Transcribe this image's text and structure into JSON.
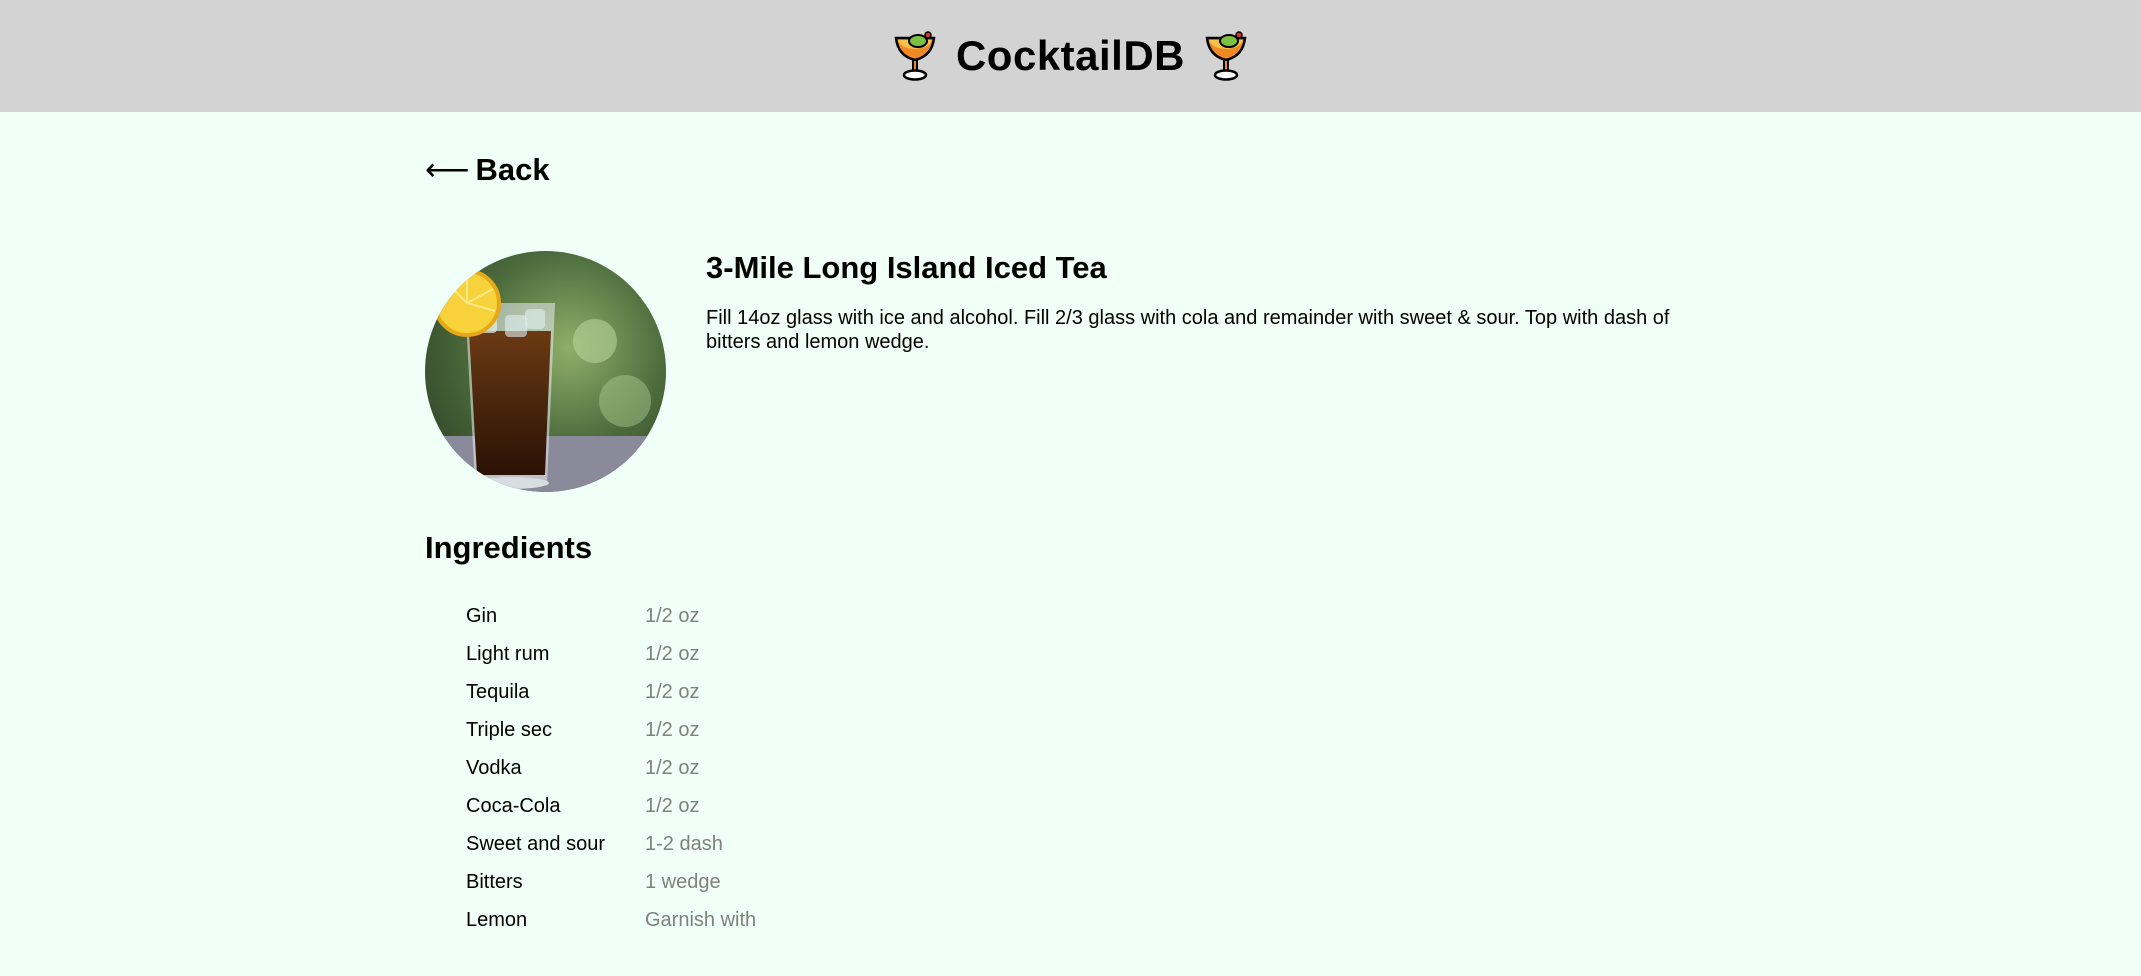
{
  "header": {
    "title": "CocktailDB",
    "left_icon": "cocktail-icon",
    "right_icon": "cocktail-icon",
    "background": "#d3d3d3"
  },
  "nav": {
    "back_arrow": "⟵",
    "back_label": "Back"
  },
  "drink": {
    "name": "3-Mile Long Island Iced Tea",
    "instructions": "Fill 14oz glass with ice and alcohol. Fill 2/3 glass with cola and remainder with sweet & sour. Top with dash of bitters and lemon wedge.",
    "photo_icon": "iced-tea-glass-with-lemon"
  },
  "ingredients": {
    "heading": "Ingredients",
    "items": [
      {
        "name": "Gin",
        "measure": "1/2 oz"
      },
      {
        "name": "Light rum",
        "measure": "1/2 oz"
      },
      {
        "name": "Tequila",
        "measure": "1/2 oz"
      },
      {
        "name": "Triple sec",
        "measure": "1/2 oz"
      },
      {
        "name": "Vodka",
        "measure": "1/2 oz"
      },
      {
        "name": "Coca-Cola",
        "measure": "1/2 oz"
      },
      {
        "name": "Sweet and sour",
        "measure": "1-2 dash"
      },
      {
        "name": "Bitters",
        "measure": "1 wedge"
      },
      {
        "name": "Lemon",
        "measure": "Garnish with"
      }
    ]
  },
  "colors": {
    "page_background": "#f0fff8",
    "measure_text": "#808080"
  }
}
